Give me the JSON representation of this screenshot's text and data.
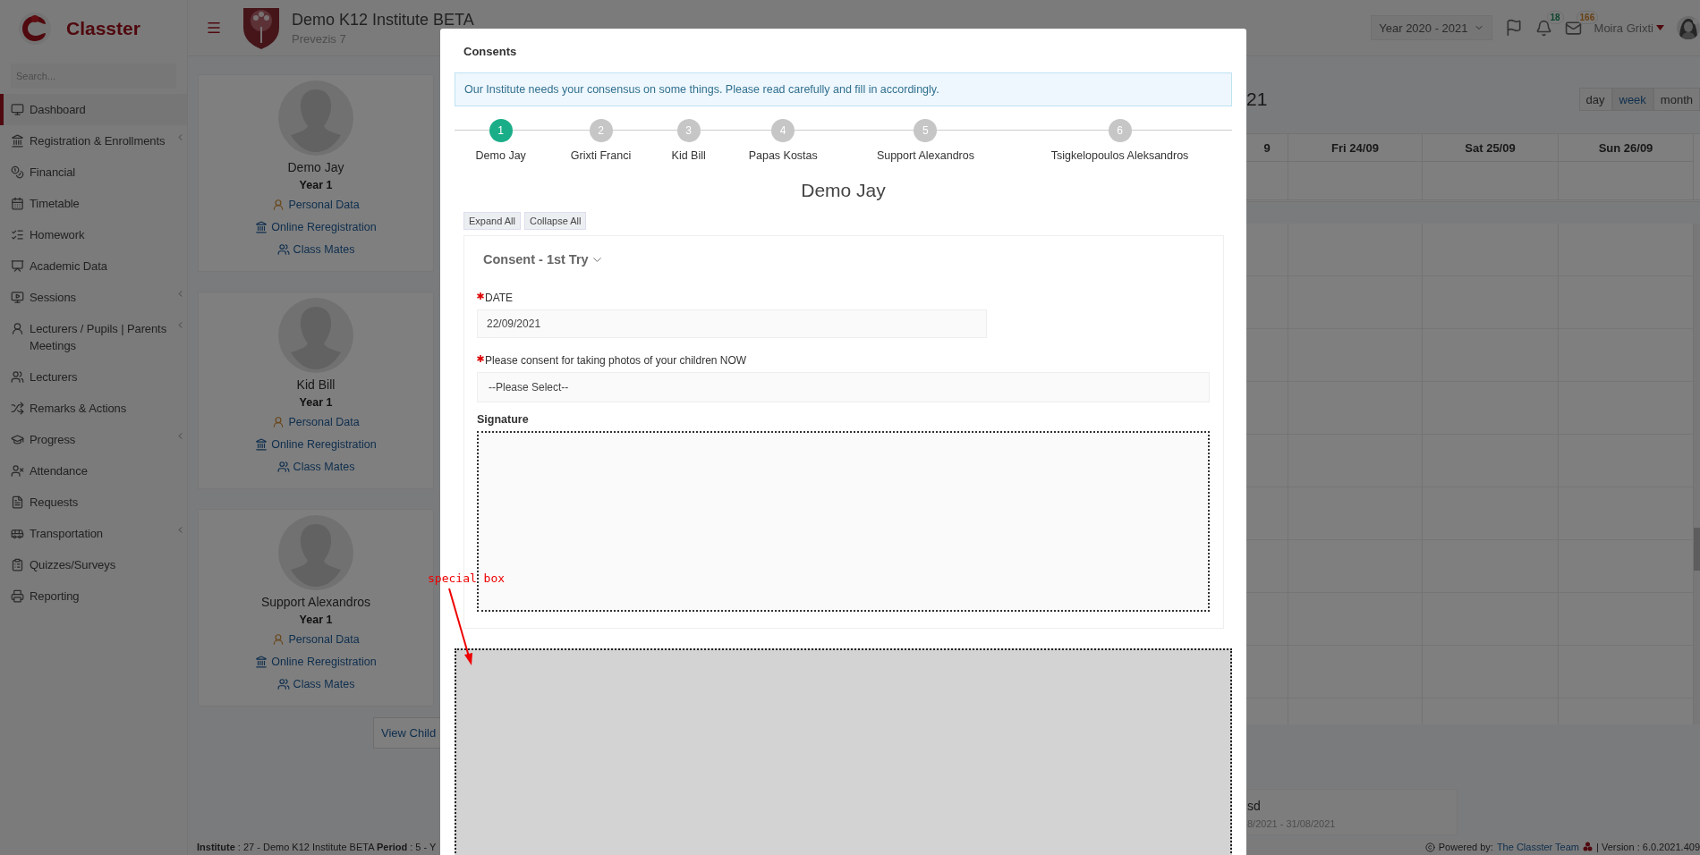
{
  "sidebar": {
    "brand": "Classter",
    "search": {
      "placeholder": "Search..."
    },
    "items": [
      {
        "label": "Dashboard",
        "selected": true,
        "has_submenu": false
      },
      {
        "label": "Registration & Enrollments",
        "selected": false,
        "has_submenu": true
      },
      {
        "label": "Financial",
        "selected": false,
        "has_submenu": false
      },
      {
        "label": "Timetable",
        "selected": false,
        "has_submenu": false
      },
      {
        "label": "Homework",
        "selected": false,
        "has_submenu": false
      },
      {
        "label": "Academic Data",
        "selected": false,
        "has_submenu": false
      },
      {
        "label": "Sessions",
        "selected": false,
        "has_submenu": true
      },
      {
        "label": "Lecturers / Pupils | Parents Meetings",
        "selected": false,
        "has_submenu": true
      },
      {
        "label": "Lecturers",
        "selected": false,
        "has_submenu": false
      },
      {
        "label": "Remarks & Actions",
        "selected": false,
        "has_submenu": false
      },
      {
        "label": "Progress",
        "selected": false,
        "has_submenu": true
      },
      {
        "label": "Attendance",
        "selected": false,
        "has_submenu": false
      },
      {
        "label": "Requests",
        "selected": false,
        "has_submenu": false
      },
      {
        "label": "Transportation",
        "selected": false,
        "has_submenu": true
      },
      {
        "label": "Quizzes/Surveys",
        "selected": false,
        "has_submenu": false
      },
      {
        "label": "Reporting",
        "selected": false,
        "has_submenu": false
      }
    ]
  },
  "header": {
    "institute": "Demo K12 Institute BETA",
    "address": "Prevezis 7",
    "year": "Year 2020 - 2021",
    "notifications": "18",
    "messages": "166",
    "user": "Moira Grixti"
  },
  "children": [
    {
      "name": "Demo Jay",
      "year": "Year 1",
      "links": [
        "Personal Data",
        "Online Reregistration",
        "Class Mates"
      ]
    },
    {
      "name": "Kid Bill",
      "year": "Year 1",
      "links": [
        "Personal Data",
        "Online Reregistration",
        "Class Mates"
      ]
    },
    {
      "name": "Support Alexandros",
      "year": "Year 1",
      "links": [
        "Personal Data",
        "Online Reregistration",
        "Class Mates"
      ]
    }
  ],
  "view_children": "View Child",
  "calendar": {
    "title": "21",
    "views": [
      {
        "label": "day",
        "selected": false
      },
      {
        "label": "week",
        "selected": true
      },
      {
        "label": "month",
        "selected": false
      }
    ],
    "columns": [
      "9",
      "Fri 24/09",
      "Sat 25/09",
      "Sun 26/09"
    ]
  },
  "event": {
    "title": "sd",
    "dates": "8/2021 - 31/08/2021"
  },
  "status_bar": {
    "institute": "**Institute** : 27 - Demo K12 Institute BETA **Period** : 5 - Y",
    "powered_by": "Powered by:",
    "team": "The Classter Team",
    "version": "| Version : 6.0.2021.409"
  },
  "modal": {
    "title": "Consents",
    "alert": "Our Institute needs your consensus on some things. Please read carefully and fill in accordingly.",
    "steps": [
      {
        "number": "1",
        "label": "Demo Jay",
        "selected": true
      },
      {
        "number": "2",
        "label": "Grixti Franci",
        "selected": false
      },
      {
        "number": "3",
        "label": "Kid Bill",
        "selected": false
      },
      {
        "number": "4",
        "label": "Papas Kostas",
        "selected": false
      },
      {
        "number": "5",
        "label": "Support Alexandros",
        "selected": false
      },
      {
        "number": "6",
        "label": "Tsigkelopoulos Aleksandros",
        "selected": false
      }
    ],
    "heading": "Demo Jay",
    "expand_all": "Expand All",
    "collapse_all": "Collapse All",
    "section": {
      "title": "Consent - 1st Try",
      "expanded": true
    },
    "fields": [
      {
        "kind": "text",
        "label": "DATE",
        "required": true,
        "value": "22/09/2021"
      },
      {
        "kind": "select",
        "label": "Please consent for taking photos of your children NOW",
        "required": true,
        "value": "--Please Select--"
      },
      {
        "kind": "signature",
        "label": "Signature",
        "required": false
      }
    ]
  },
  "annotation": {
    "text": "special box"
  }
}
